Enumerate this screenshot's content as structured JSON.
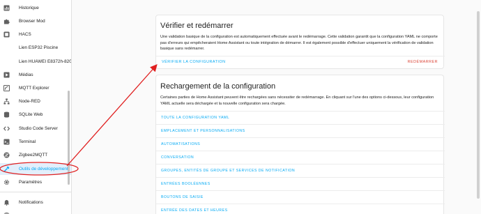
{
  "sidebar": {
    "items": [
      {
        "label": "Historique",
        "icon": "chart-box-icon"
      },
      {
        "label": "Browser Mod",
        "icon": "puzzle-icon"
      },
      {
        "label": "HACS",
        "icon": "hacs-icon"
      },
      {
        "label": "Lien ESP32 Piscine",
        "icon": ""
      },
      {
        "label": "Lien HUAWEI E8372h-820",
        "icon": ""
      },
      {
        "label": "Médias",
        "icon": "play-box-icon"
      },
      {
        "label": "MQTT Explorer",
        "icon": "mqtt-icon"
      },
      {
        "label": "Node-RED",
        "icon": "sitemap-icon"
      },
      {
        "label": "SQLite Web",
        "icon": "database-icon"
      },
      {
        "label": "Studio Code Server",
        "icon": "code-icon"
      },
      {
        "label": "Terminal",
        "icon": "console-icon"
      },
      {
        "label": "Zigbee2MQTT",
        "icon": "zigbee-icon"
      },
      {
        "label": "Outils de développement",
        "icon": "hammer-icon"
      },
      {
        "label": "Paramètres",
        "icon": "cog-icon"
      },
      {
        "label": "Notifications",
        "icon": "bell-icon"
      }
    ],
    "active_index": 12
  },
  "verify_card": {
    "title": "Vérifier et redémarrer",
    "description": "Une validation basique de la configuration est automatiquement effectuée avant le redémarrage. Cette validation garantit que la configuration YAML ne comporte pas d'erreurs qui empêcheraient Home Assistant ou toute intégration de démarrer. Il est également possible d'effectuer uniquement la vérification de validation basique sans redémarrer.",
    "check_button": "Vérifier la configuration",
    "restart_button": "Redémarrer"
  },
  "reload_card": {
    "title": "Rechargement de la configuration",
    "description": "Certaines parties de Home Assistant peuvent être rechargées sans nécessiter de redémarrage. En cliquant sur l'une des options ci-dessous, leur configuration YAML actuelle sera déchargée et la nouvelle configuration sera chargée.",
    "items": [
      "Toute la configuration YAML",
      "Emplacement et personnalisations",
      "Automatisations",
      "Conversation",
      "Groupes, entités de groupe et services de notification",
      "Entrées booléennes",
      "Boutons de saisie",
      "Entrée des dates et heures"
    ]
  },
  "colors": {
    "accent": "#03a9f4",
    "annotation": "#e02020",
    "danger": "#db4437"
  }
}
